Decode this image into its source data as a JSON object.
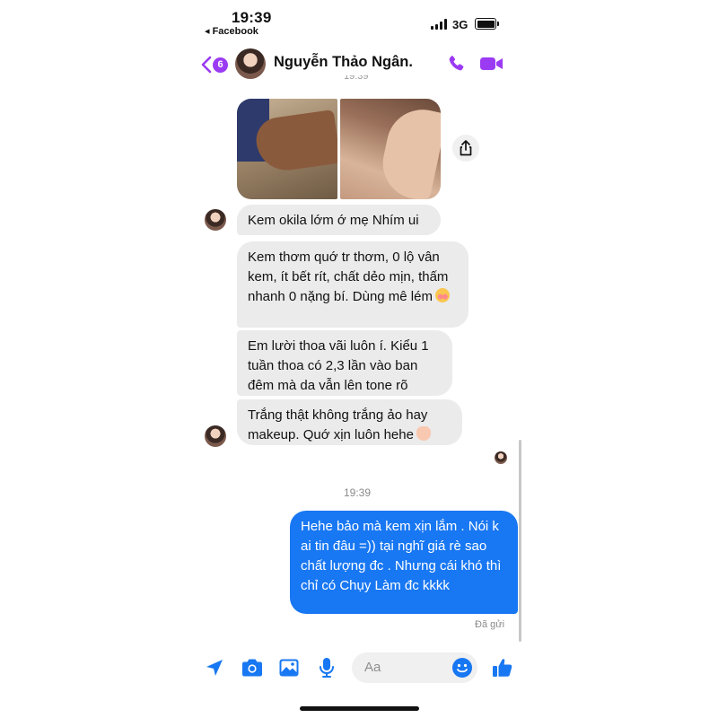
{
  "status_bar": {
    "time": "19:39",
    "back_app": "◂ Facebook",
    "network": "3G"
  },
  "header": {
    "back_badge": "6",
    "contact_name": "Nguyễn Thảo Ngân.",
    "accent_color": "#9b3af3"
  },
  "messages": {
    "partial_timestamp": "19:39",
    "incoming": [
      {
        "text": "Kem okila lớm ớ mẹ Nhím ui"
      },
      {
        "text": "Kem thơm quớ tr thơm, 0 lộ vân kem, ít bết rít, chất dẻo mịn, thấm nhanh 0 nặng bí. Dùng mê lém",
        "emoji": "blush-emoji"
      },
      {
        "text": "Em lười thoa vãi luôn í. Kiểu 1 tuần thoa có 2,3 lần vào ban đêm mà da vẫn lên tone rõ"
      },
      {
        "text": "Trắng thật không trắng ảo hay makeup. Quớ xịn luôn hehe",
        "emoji": "heart-hands-emoji"
      }
    ],
    "timestamp": "19:39",
    "outgoing": {
      "text": "Hehe bảo mà kem xịn lắm . Nói k ai tin đâu =)) tại nghĩ giá rè sao chất lượng đc . Nhưng cái khó thì chỉ có Chụy Làm đc kkkk"
    },
    "delivery_status": "Đã gửi",
    "outgoing_color": "#1877f2"
  },
  "composer": {
    "placeholder": "Aa",
    "accent_color": "#1877f2"
  }
}
